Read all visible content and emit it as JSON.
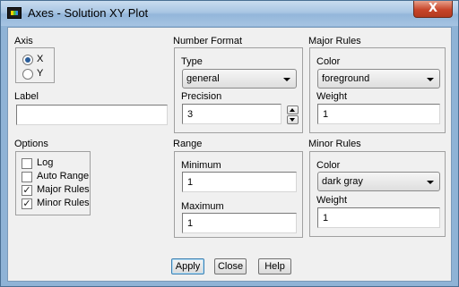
{
  "window": {
    "title": "Axes - Solution XY Plot",
    "close_glyph": "X",
    "icon": "app-logo-icon"
  },
  "axis": {
    "heading": "Axis",
    "options": [
      {
        "label": "X",
        "selected": true
      },
      {
        "label": "Y",
        "selected": false
      }
    ]
  },
  "label": {
    "heading": "Label",
    "value": ""
  },
  "options": {
    "heading": "Options",
    "items": [
      {
        "label": "Log",
        "checked": false
      },
      {
        "label": "Auto Range",
        "checked": false
      },
      {
        "label": "Major Rules",
        "checked": true
      },
      {
        "label": "Minor Rules",
        "checked": true
      }
    ],
    "check_glyph": "✓"
  },
  "number_format": {
    "heading": "Number Format",
    "type_label": "Type",
    "type_value": "general",
    "precision_label": "Precision",
    "precision_value": "3"
  },
  "range": {
    "heading": "Range",
    "minimum_label": "Minimum",
    "minimum_value": "1",
    "maximum_label": "Maximum",
    "maximum_value": "1"
  },
  "major_rules": {
    "heading": "Major Rules",
    "color_label": "Color",
    "color_value": "foreground",
    "weight_label": "Weight",
    "weight_value": "1"
  },
  "minor_rules": {
    "heading": "Minor Rules",
    "color_label": "Color",
    "color_value": "dark gray",
    "weight_label": "Weight",
    "weight_value": "1"
  },
  "buttons": {
    "apply": "Apply",
    "close": "Close",
    "help": "Help"
  }
}
